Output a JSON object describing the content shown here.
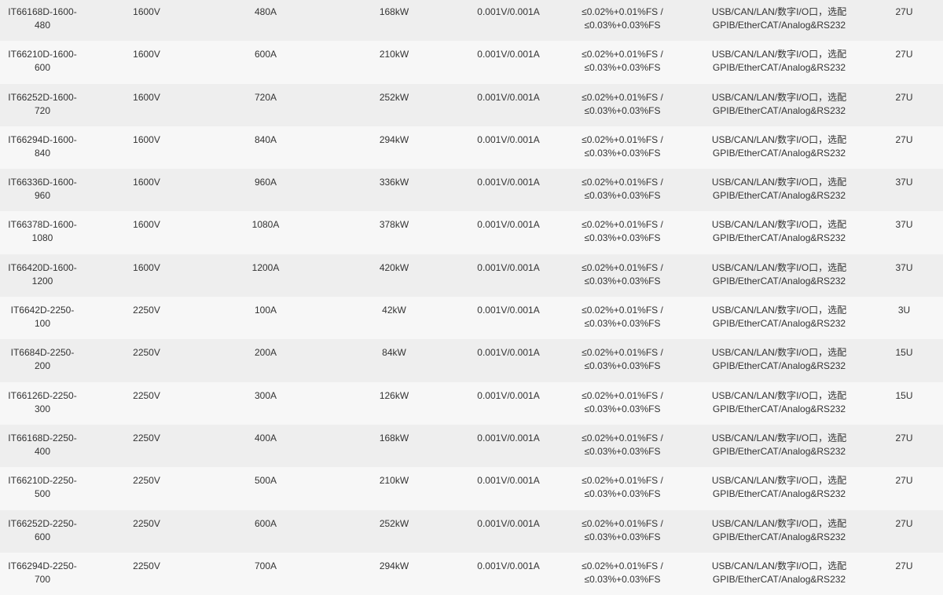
{
  "table": {
    "rows": [
      [
        "IT66168D-1600-\n480",
        "1600V",
        "480A",
        "168kW",
        "0.001V/0.001A",
        "≤0.02%+0.01%FS /\n≤0.03%+0.03%FS",
        "USB/CAN/LAN/数字I/O口，选配\nGPIB/EtherCAT/Analog&RS232",
        "27U"
      ],
      [
        "IT66210D-1600-\n600",
        "1600V",
        "600A",
        "210kW",
        "0.001V/0.001A",
        "≤0.02%+0.01%FS /\n≤0.03%+0.03%FS",
        "USB/CAN/LAN/数字I/O口，选配\nGPIB/EtherCAT/Analog&RS232",
        "27U"
      ],
      [
        "IT66252D-1600-\n720",
        "1600V",
        "720A",
        "252kW",
        "0.001V/0.001A",
        "≤0.02%+0.01%FS /\n≤0.03%+0.03%FS",
        "USB/CAN/LAN/数字I/O口，选配\nGPIB/EtherCAT/Analog&RS232",
        "27U"
      ],
      [
        "IT66294D-1600-\n840",
        "1600V",
        "840A",
        "294kW",
        "0.001V/0.001A",
        "≤0.02%+0.01%FS /\n≤0.03%+0.03%FS",
        "USB/CAN/LAN/数字I/O口，选配\nGPIB/EtherCAT/Analog&RS232",
        "27U"
      ],
      [
        "IT66336D-1600-\n960",
        "1600V",
        "960A",
        "336kW",
        "0.001V/0.001A",
        "≤0.02%+0.01%FS /\n≤0.03%+0.03%FS",
        "USB/CAN/LAN/数字I/O口，选配\nGPIB/EtherCAT/Analog&RS232",
        "37U"
      ],
      [
        "IT66378D-1600-\n1080",
        "1600V",
        "1080A",
        "378kW",
        "0.001V/0.001A",
        "≤0.02%+0.01%FS /\n≤0.03%+0.03%FS",
        "USB/CAN/LAN/数字I/O口，选配\nGPIB/EtherCAT/Analog&RS232",
        "37U"
      ],
      [
        "IT66420D-1600-\n1200",
        "1600V",
        "1200A",
        "420kW",
        "0.001V/0.001A",
        "≤0.02%+0.01%FS /\n≤0.03%+0.03%FS",
        "USB/CAN/LAN/数字I/O口，选配\nGPIB/EtherCAT/Analog&RS232",
        "37U"
      ],
      [
        "IT6642D-2250-\n100",
        "2250V",
        "100A",
        "42kW",
        "0.001V/0.001A",
        "≤0.02%+0.01%FS /\n≤0.03%+0.03%FS",
        "USB/CAN/LAN/数字I/O口，选配\nGPIB/EtherCAT/Analog&RS232",
        "3U"
      ],
      [
        "IT6684D-2250-\n200",
        "2250V",
        "200A",
        "84kW",
        "0.001V/0.001A",
        "≤0.02%+0.01%FS /\n≤0.03%+0.03%FS",
        "USB/CAN/LAN/数字I/O口，选配\nGPIB/EtherCAT/Analog&RS232",
        "15U"
      ],
      [
        "IT66126D-2250-\n300",
        "2250V",
        "300A",
        "126kW",
        "0.001V/0.001A",
        "≤0.02%+0.01%FS /\n≤0.03%+0.03%FS",
        "USB/CAN/LAN/数字I/O口，选配\nGPIB/EtherCAT/Analog&RS232",
        "15U"
      ],
      [
        "IT66168D-2250-\n400",
        "2250V",
        "400A",
        "168kW",
        "0.001V/0.001A",
        "≤0.02%+0.01%FS /\n≤0.03%+0.03%FS",
        "USB/CAN/LAN/数字I/O口，选配\nGPIB/EtherCAT/Analog&RS232",
        "27U"
      ],
      [
        "IT66210D-2250-\n500",
        "2250V",
        "500A",
        "210kW",
        "0.001V/0.001A",
        "≤0.02%+0.01%FS /\n≤0.03%+0.03%FS",
        "USB/CAN/LAN/数字I/O口，选配\nGPIB/EtherCAT/Analog&RS232",
        "27U"
      ],
      [
        "IT66252D-2250-\n600",
        "2250V",
        "600A",
        "252kW",
        "0.001V/0.001A",
        "≤0.02%+0.01%FS /\n≤0.03%+0.03%FS",
        "USB/CAN/LAN/数字I/O口，选配\nGPIB/EtherCAT/Analog&RS232",
        "27U"
      ],
      [
        "IT66294D-2250-\n700",
        "2250V",
        "700A",
        "294kW",
        "0.001V/0.001A",
        "≤0.02%+0.01%FS /\n≤0.03%+0.03%FS",
        "USB/CAN/LAN/数字I/O口，选配\nGPIB/EtherCAT/Analog&RS232",
        "27U"
      ]
    ]
  },
  "colors": {
    "row_odd": "#eeeeee",
    "row_even": "#f7f7f7",
    "text": "#333333"
  }
}
